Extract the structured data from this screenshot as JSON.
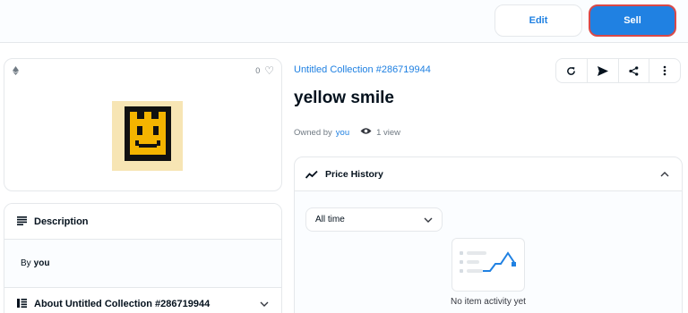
{
  "header": {
    "edit_label": "Edit",
    "sell_label": "Sell"
  },
  "item": {
    "likes": "0",
    "collection": "Untitled Collection #286719944",
    "title": "yellow smile",
    "owned_by_prefix": "Owned by",
    "owner": "you",
    "views": "1 view"
  },
  "description": {
    "heading": "Description",
    "by_prefix": "By",
    "creator": "you",
    "about_heading": "About Untitled Collection #286719944"
  },
  "price_history": {
    "heading": "Price History",
    "range_selected": "All time",
    "empty_text": "No item activity yet"
  },
  "colors": {
    "accent": "#2081e2",
    "nft_background": "#f7e5b4",
    "nft_face": "#f4b400"
  },
  "icons": [
    "ethereum-icon",
    "heart-icon",
    "refresh-icon",
    "send-icon",
    "share-icon",
    "more-icon",
    "eye-icon",
    "trend-icon",
    "description-icon",
    "collection-icon",
    "chevron-down-icon",
    "chevron-up-icon"
  ]
}
